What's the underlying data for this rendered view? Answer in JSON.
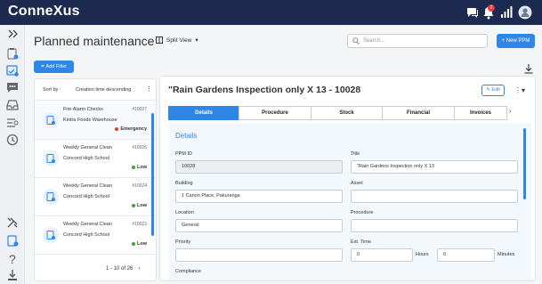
{
  "app": {
    "logo": "ConneXus",
    "notification_count": "2"
  },
  "page": {
    "title": "Planned maintenance",
    "view_mode": "Split View",
    "search_placeholder": "Search...",
    "new_button": "+ New PPM",
    "add_filter": "Add Filter"
  },
  "list": {
    "sort_label": "Sort by :",
    "sort_value": "Creation time descending",
    "items": [
      {
        "title": "Fire Alarm Checks",
        "id": "#10027",
        "site": "Kintra Foods Warehouse",
        "priority": "Emergency",
        "priority_color": "#e53935"
      },
      {
        "title": "Weekly General Clean",
        "id": "#10026",
        "site": "Concord High School",
        "priority": "Low",
        "priority_color": "#43a047"
      },
      {
        "title": "Weekly General Clean",
        "id": "#10024",
        "site": "Concord High School",
        "priority": "Low",
        "priority_color": "#43a047"
      },
      {
        "title": "Weekly General Clean",
        "id": "#10023",
        "site": "Concord High School",
        "priority": "Low",
        "priority_color": "#43a047"
      }
    ],
    "pagination": "1 - 10 of 26"
  },
  "detail": {
    "title": "\"Rain Gardens Inspection only X 13 - 10028",
    "edit_label": "Edit",
    "tabs": [
      "Details",
      "Procedure",
      "Stock",
      "Financial",
      "Invoices"
    ],
    "section": "Details",
    "fields": {
      "ppm_id": {
        "label": "PPM ID",
        "value": "10028"
      },
      "title": {
        "label": "Title",
        "value": "\"Rain Gardens Inspection only X 13"
      },
      "building": {
        "label": "Building",
        "value": "1 Canon Place, Pakuranga"
      },
      "asset": {
        "label": "Asset",
        "value": ""
      },
      "location": {
        "label": "Location",
        "value": "General"
      },
      "procedure": {
        "label": "Procedure",
        "value": ""
      },
      "priority": {
        "label": "Priority",
        "value": ""
      },
      "est_time": {
        "label": "Est. Time",
        "hours": "0",
        "hours_unit": "Hours",
        "minutes": "0",
        "minutes_unit": "Minutes"
      },
      "compliance": {
        "label": "Compliance"
      }
    }
  },
  "colors": {
    "topbar": "#1b2a4e",
    "accent": "#2e86e6"
  }
}
